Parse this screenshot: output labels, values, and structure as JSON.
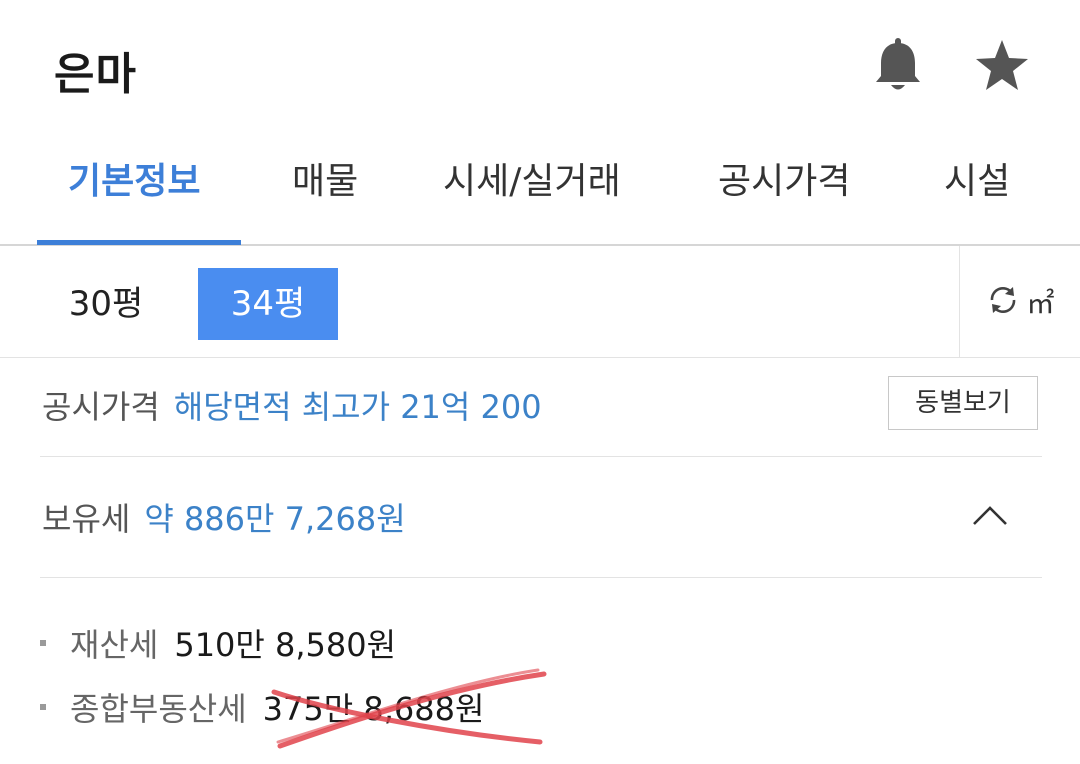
{
  "header": {
    "title": "은마",
    "bell_icon": "bell-icon",
    "star_icon": "star-icon"
  },
  "tabs": [
    {
      "label": "기본정보",
      "active": true
    },
    {
      "label": "매물"
    },
    {
      "label": "시세/실거래"
    },
    {
      "label": "공시가격"
    },
    {
      "label": "시설"
    }
  ],
  "area": {
    "option_1": "30평",
    "option_2": "34평",
    "selected": "34평",
    "unit_label": "㎡",
    "accent": "#4a8df0"
  },
  "public_price": {
    "label": "공시가격",
    "value": "해당면적 최고가 21억 200",
    "button": "동별보기"
  },
  "holding_tax": {
    "label": "보유세",
    "value": "약 886만 7,268원"
  },
  "details": [
    {
      "label": "재산세",
      "value": "510만 8,580원"
    },
    {
      "label": "종합부동산세",
      "value": "375만 8,688원"
    }
  ],
  "colors": {
    "tab_active": "#3d7fd8",
    "value_blue": "#3c82c8",
    "strike_red": "#e0434b"
  }
}
